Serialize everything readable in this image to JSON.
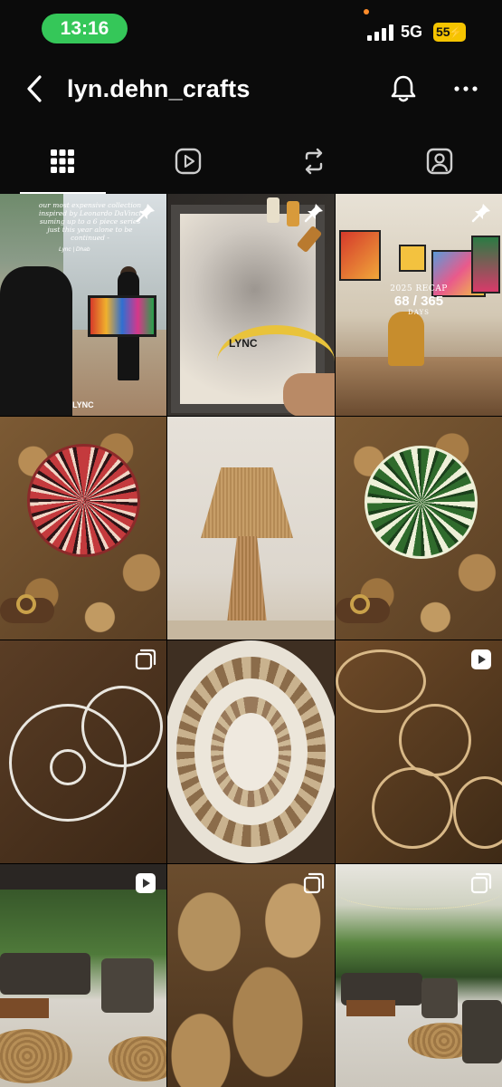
{
  "status_bar": {
    "time": "13:16",
    "network": "5G",
    "battery": "55",
    "time_pill_color": "#35c759",
    "battery_color": "#f5c400"
  },
  "header": {
    "back_icon": "chevron-left-icon",
    "username": "lyn.dehn_crafts",
    "bell_icon": "bell-icon",
    "more_icon": "more-horizontal-icon"
  },
  "tabs": [
    {
      "icon": "grid-icon",
      "active": true
    },
    {
      "icon": "reels-icon",
      "active": false
    },
    {
      "icon": "reposts-icon",
      "active": false
    },
    {
      "icon": "tagged-icon",
      "active": false
    }
  ],
  "posts": [
    {
      "badge": "pin-icon",
      "caption": "our most expensive collection inspired by Leonardo DaVinci suming up to a 6 piece series just this year alone to be continued -",
      "signature": "Lync | Dhab",
      "logo": "LYNC"
    },
    {
      "badge": "pin-icon",
      "logo": "LYNC"
    },
    {
      "badge": "pin-icon",
      "recap_title": "2025 RECAP",
      "recap_count": "68 / 365",
      "recap_unit": "DAYS"
    },
    {
      "badge": null
    },
    {
      "badge": null
    },
    {
      "badge": null
    },
    {
      "badge": "carousel-icon"
    },
    {
      "badge": null
    },
    {
      "badge": "reel-icon"
    },
    {
      "badge": "reel-icon"
    },
    {
      "badge": "carousel-icon"
    },
    {
      "badge": "carousel-icon"
    }
  ]
}
